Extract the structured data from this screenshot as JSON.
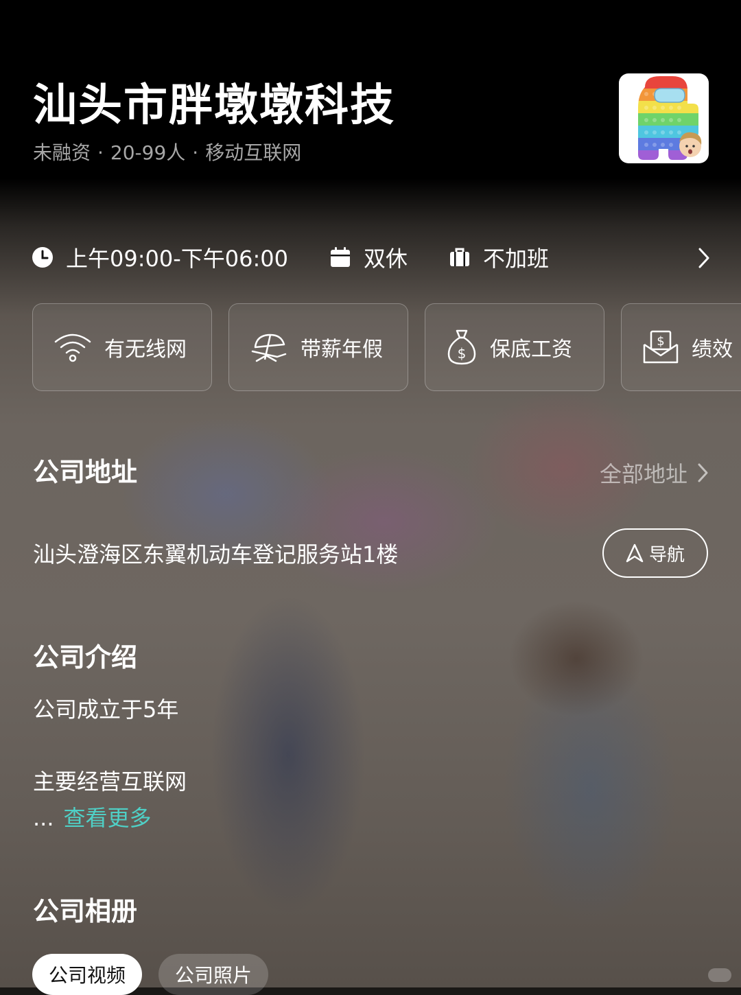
{
  "header": {
    "company_name": "汕头市胖墩墩科技",
    "funding": "未融资",
    "size": "20-99人",
    "industry": "移动互联网",
    "separator": "·"
  },
  "work_info": {
    "hours": "上午09:00-下午06:00",
    "rest": "双休",
    "overtime": "不加班"
  },
  "benefits": [
    {
      "label": "有无线网",
      "icon": "wifi-icon"
    },
    {
      "label": "带薪年假",
      "icon": "beach-chair-icon"
    },
    {
      "label": "保底工资",
      "icon": "money-bag-icon"
    },
    {
      "label": "绩效",
      "icon": "money-envelope-icon"
    }
  ],
  "address_section": {
    "title": "公司地址",
    "all_label": "全部地址",
    "address": "汕头澄海区东翼机动车登记服务站1楼",
    "nav_label": "导航"
  },
  "intro_section": {
    "title": "公司介绍",
    "line1": "公司成立于5年",
    "line2": "主要经营互联网",
    "ellipsis": "...",
    "more_label": "查看更多"
  },
  "album_section": {
    "title": "公司相册",
    "tabs": [
      "公司视频",
      "公司照片"
    ]
  },
  "colors": {
    "accent": "#4fd0c6",
    "header_bg": "#000000",
    "muted_text": "#a7a7a7"
  }
}
